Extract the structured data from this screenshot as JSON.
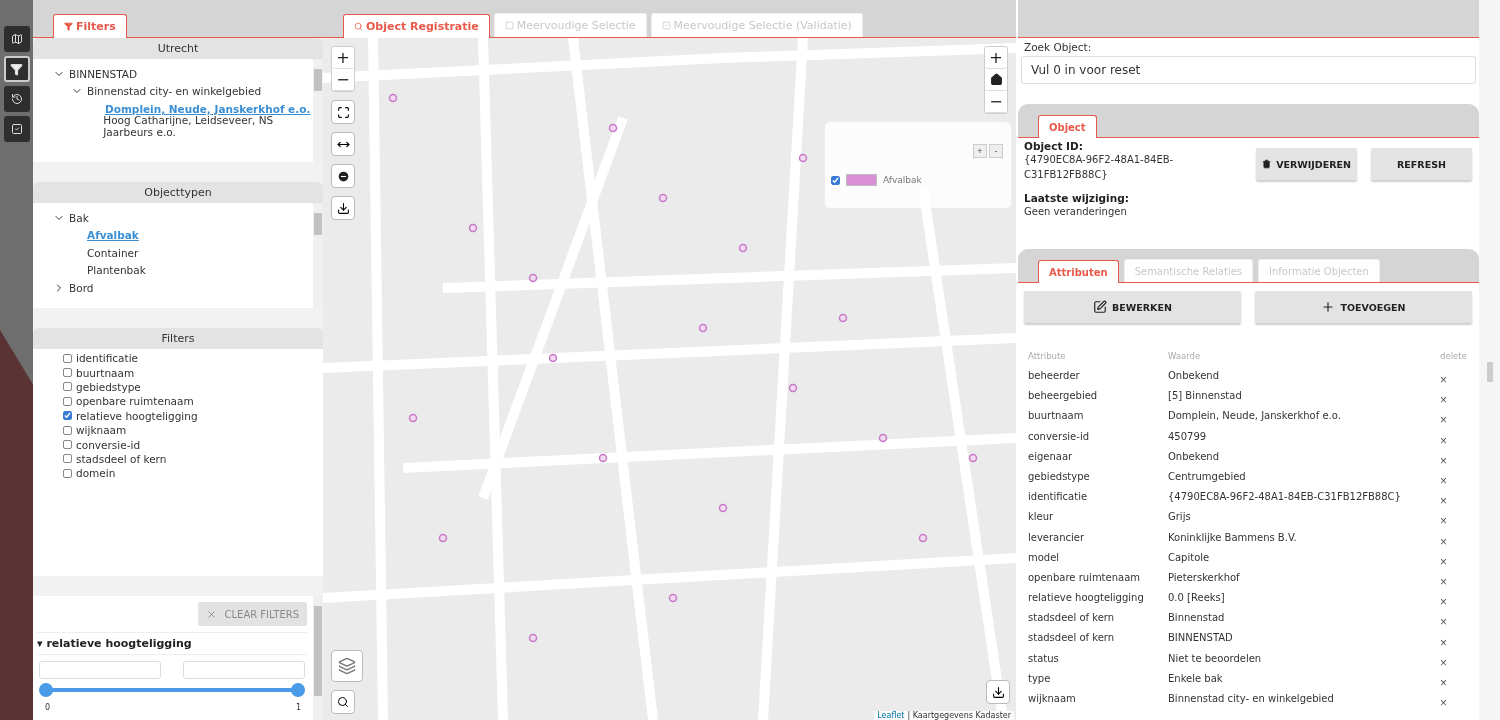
{
  "rail": [
    {
      "kind": "map",
      "selected": false
    },
    {
      "kind": "filter",
      "selected": true
    },
    {
      "kind": "history",
      "selected": false
    },
    {
      "kind": "check",
      "selected": false
    }
  ],
  "left_tabs": [
    {
      "label": "Filters",
      "selected": true
    }
  ],
  "region_tree": {
    "title": "Utrecht",
    "items": [
      {
        "label": "BINNENSTAD",
        "expanded": true,
        "selected": false,
        "children": [
          {
            "label": "Binnenstad city- en winkelgebied",
            "expanded": true,
            "selected": false,
            "children": [
              {
                "label": "Domplein, Neude, Janskerkhof e.o.",
                "selected": true
              },
              {
                "label": "Hoog Catharijne, Leidseveer, NS Jaarbeurs e.o.",
                "selected": false
              }
            ]
          }
        ]
      }
    ]
  },
  "type_tree": {
    "title": "Objecttypen",
    "items": [
      {
        "label": "Bak",
        "expanded": true,
        "selected": false,
        "children": [
          {
            "label": "Afvalbak",
            "selected": true
          },
          {
            "label": "Container",
            "selected": false
          },
          {
            "label": "Plantenbak",
            "selected": false
          }
        ]
      },
      {
        "label": "Bord",
        "expanded": false,
        "selected": false
      }
    ]
  },
  "filters": {
    "title": "Filters",
    "items": [
      {
        "label": "identificatie",
        "checked": false
      },
      {
        "label": "buurtnaam",
        "checked": false
      },
      {
        "label": "gebiedstype",
        "checked": false
      },
      {
        "label": "openbare ruimtenaam",
        "checked": false
      },
      {
        "label": "relatieve hoogteligging",
        "checked": true
      },
      {
        "label": "wijknaam",
        "checked": false
      },
      {
        "label": "conversie-id",
        "checked": false
      },
      {
        "label": "stadsdeel of kern",
        "checked": false
      },
      {
        "label": "domein",
        "checked": false
      }
    ],
    "clear_button": {
      "label": "CLEAR FILTERS",
      "disabled": true
    },
    "range": {
      "marker": "▾",
      "title": "relatieve hoogteligging",
      "thumbs": [
        {
          "level": 0
        },
        {
          "level": 1
        }
      ],
      "min_label": "0",
      "max_label": "1"
    }
  },
  "map_tabs": [
    {
      "label": "Object Registratie",
      "selected": true
    },
    {
      "label": "Meervoudige Selectie",
      "selected": false
    },
    {
      "label": "Meervoudige Selectie (Validatie)",
      "selected": false
    }
  ],
  "map": {
    "controls_left": [
      "+",
      "−"
    ],
    "controls_right": [
      "+",
      "−"
    ],
    "legend": {
      "items": [
        {
          "label": "Afvalbak",
          "checked": true,
          "color": "#d98fd6"
        }
      ],
      "buttons": [
        "+",
        "-"
      ]
    },
    "attribution_link": "Leaflet",
    "attribution": "| Kaartgegevens Kadaster"
  },
  "search": {
    "label": "Zoek Object:",
    "value": "Vul 0 in voor reset"
  },
  "object_tabs": [
    {
      "label": "Object",
      "selected": true
    }
  ],
  "object": {
    "id_label": "Object ID:",
    "id": "{4790EC8A-96F2-48A1-84EB-C31FB12FB88C}",
    "changed_label": "Laatste wijziging:",
    "changed": "Geen veranderingen",
    "buttons": [
      {
        "kind": "delete",
        "label": "VERWIJDEREN"
      },
      {
        "kind": "refresh",
        "label": "REFRESH"
      }
    ]
  },
  "attr_tabs": [
    {
      "label": "Attributen",
      "selected": true
    },
    {
      "label": "Semantische Relaties",
      "selected": false
    },
    {
      "label": "Informatie Objecten",
      "selected": false
    }
  ],
  "attr_buttons": [
    {
      "kind": "edit",
      "label": "BEWERKEN"
    },
    {
      "kind": "add",
      "label": "TOEVOEGEN"
    }
  ],
  "table": {
    "columns": [
      "Attribute",
      "Waarde",
      "delete"
    ],
    "rows": [
      [
        "beheerder",
        "Onbekend"
      ],
      [
        "beheergebied",
        "[5] Binnenstad"
      ],
      [
        "buurtnaam",
        "Domplein, Neude, Janskerkhof e.o."
      ],
      [
        "conversie-id",
        "450799"
      ],
      [
        "eigenaar",
        "Onbekend"
      ],
      [
        "gebiedstype",
        "Centrumgebied"
      ],
      [
        "identificatie",
        "{4790EC8A-96F2-48A1-84EB-C31FB12FB88C}"
      ],
      [
        "kleur",
        "Grijs"
      ],
      [
        "leverancier",
        "Koninklijke Bammens B.V."
      ],
      [
        "model",
        "Capitole"
      ],
      [
        "openbare ruimtenaam",
        "Pieterskerkhof"
      ],
      [
        "relatieve hoogteligging",
        "0.0 [Reeks]"
      ],
      [
        "stadsdeel of kern",
        "Binnenstad"
      ],
      [
        "stadsdeel of kern",
        "BINNENSTAD"
      ],
      [
        "status",
        "Niet te beoordelen"
      ],
      [
        "type",
        "Enkele bak"
      ],
      [
        "wijknaam",
        "Binnenstad city- en winkelgebied"
      ]
    ],
    "delete_mark": "×"
  }
}
